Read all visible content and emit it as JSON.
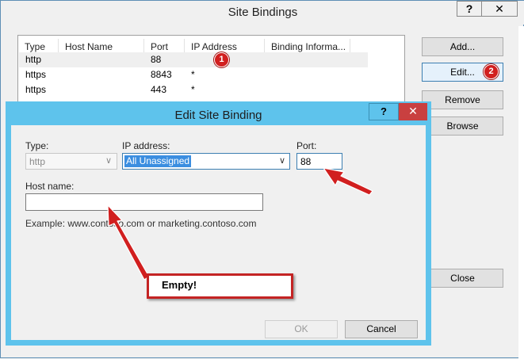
{
  "site_bindings": {
    "title": "Site Bindings",
    "help_label": "?",
    "close_label": "✕",
    "columns": [
      "Type",
      "Host Name",
      "Port",
      "IP Address",
      "Binding Informa..."
    ],
    "rows": [
      {
        "type": "http",
        "host": "",
        "port": "88",
        "ip": ""
      },
      {
        "type": "https",
        "host": "",
        "port": "8843",
        "ip": "*"
      },
      {
        "type": "https",
        "host": "",
        "port": "443",
        "ip": "*"
      }
    ],
    "buttons": {
      "add": "Add...",
      "edit": "Edit...",
      "remove": "Remove",
      "browse": "Browse",
      "close": "Close"
    }
  },
  "badges": {
    "one": "1",
    "two": "2"
  },
  "edit_dialog": {
    "title": "Edit Site Binding",
    "help_label": "?",
    "close_label": "✕",
    "type_label": "Type:",
    "type_value": "http",
    "ip_label": "IP address:",
    "ip_value": "All Unassigned",
    "port_label": "Port:",
    "port_value": "88",
    "host_label": "Host name:",
    "host_value": "",
    "example_text": "Example: www.contoso.com or marketing.contoso.com",
    "ok_label": "OK",
    "cancel_label": "Cancel"
  },
  "annotation": {
    "empty_label": "Empty!"
  },
  "colors": {
    "accent": "#5ec3ec",
    "arrow": "#d11f1f",
    "selection": "#3b8ee0"
  }
}
